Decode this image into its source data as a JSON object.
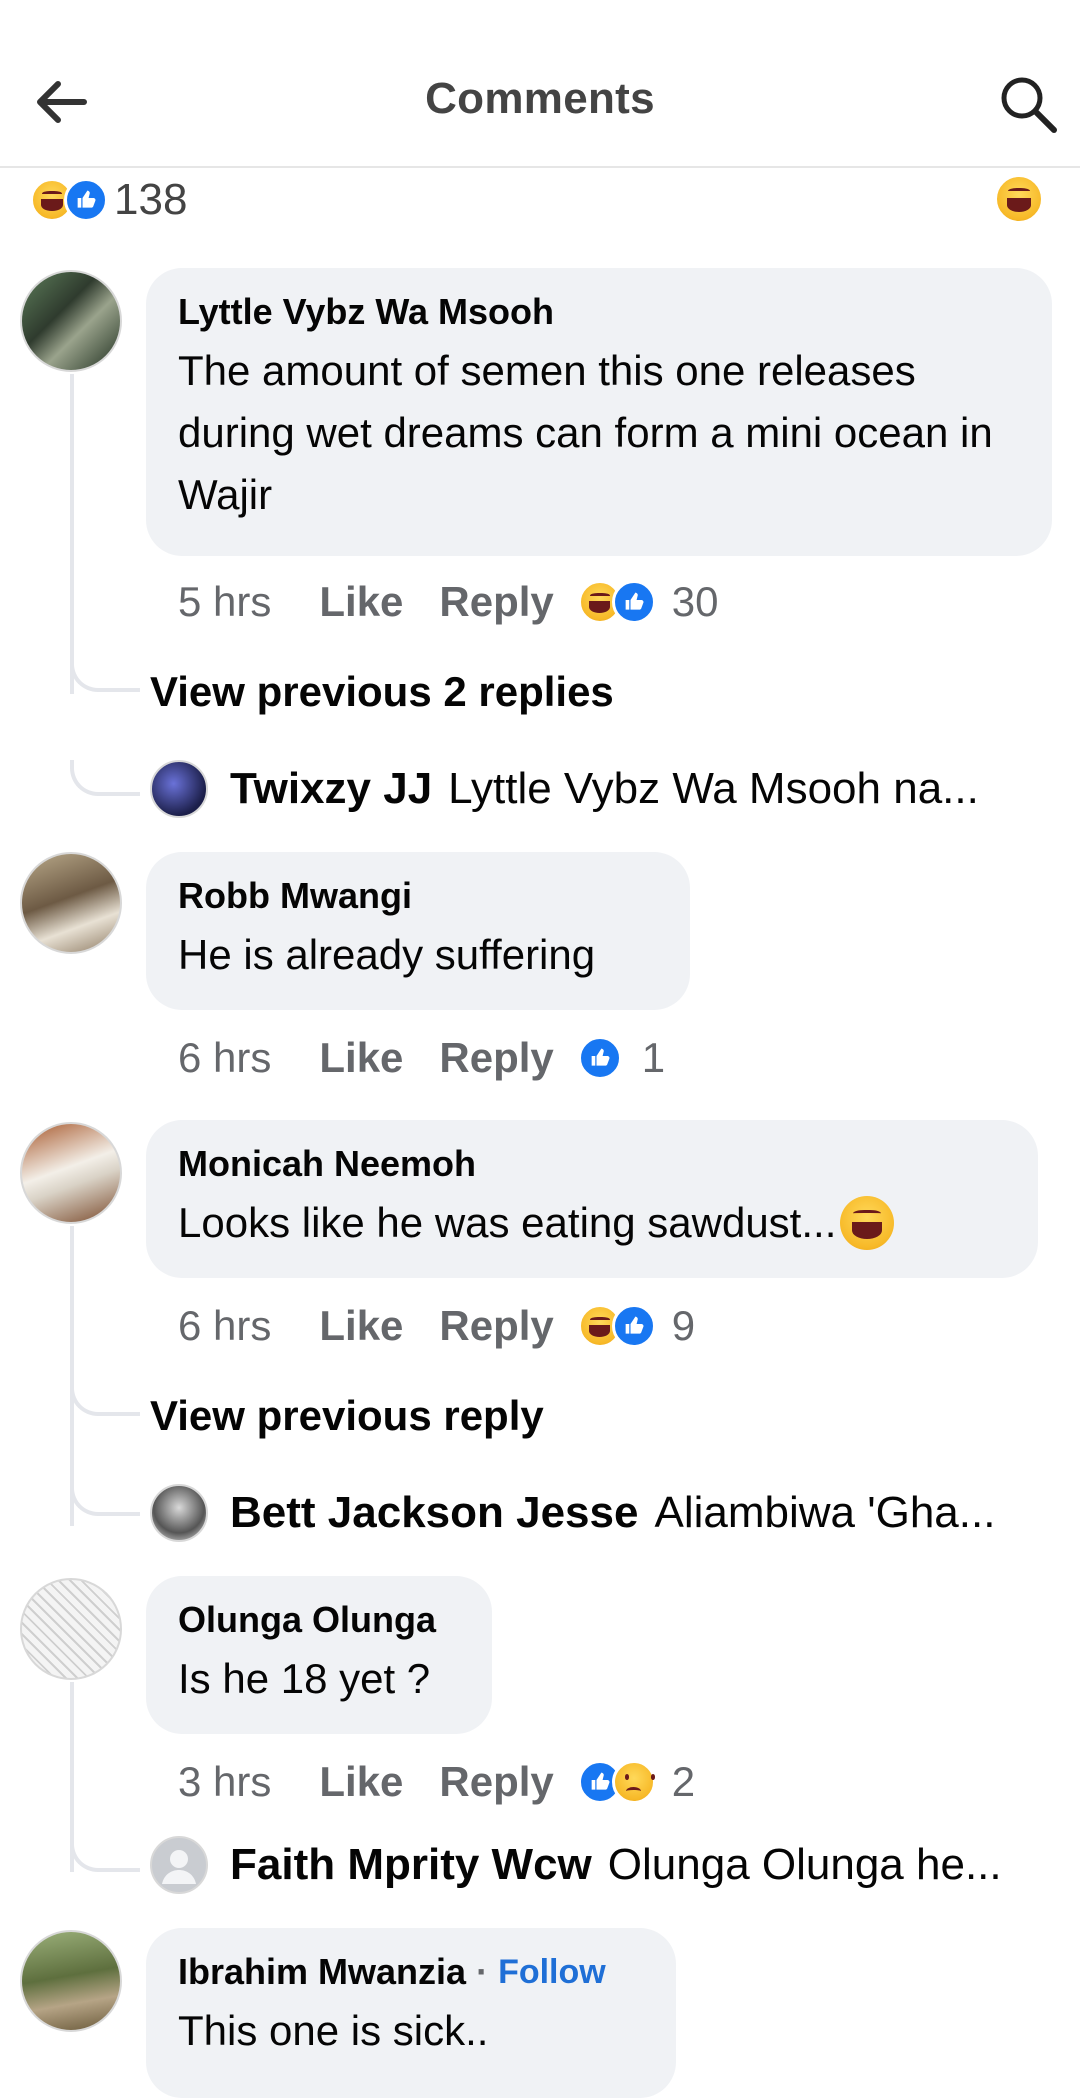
{
  "header": {
    "title": "Comments"
  },
  "summary": {
    "count": "138"
  },
  "comments": [
    {
      "author": "Lyttle Vybz Wa Msooh",
      "text": "The amount of semen this one releases during wet dreams can form a mini ocean in Wajir",
      "time": "5 hrs",
      "like": "Like",
      "reply": "Reply",
      "reaction_count": "30",
      "view_previous": "View previous 2 replies",
      "latest_reply": {
        "name": "Twixzy JJ",
        "text": "Lyttle Vybz Wa Msooh na..."
      }
    },
    {
      "author": "Robb Mwangi",
      "text": "He is already suffering",
      "time": "6 hrs",
      "like": "Like",
      "reply": "Reply",
      "reaction_count": "1"
    },
    {
      "author": "Monicah Neemoh",
      "text": "Looks like he was eating sawdust...",
      "time": "6 hrs",
      "like": "Like",
      "reply": "Reply",
      "reaction_count": "9",
      "view_previous": "View previous reply",
      "latest_reply": {
        "name": "Bett Jackson Jesse",
        "text": "Aliambiwa 'Gha..."
      }
    },
    {
      "author": "Olunga Olunga",
      "text": "Is he 18 yet ?",
      "time": "3 hrs",
      "like": "Like",
      "reply": "Reply",
      "reaction_count": "2",
      "latest_reply": {
        "name": "Faith Mprity Wcw",
        "text": "Olunga Olunga he..."
      }
    },
    {
      "author": "Ibrahim Mwanzia",
      "follow": "Follow",
      "text": "This one is sick.."
    }
  ],
  "colors": {
    "bubble": "#f0f2f5",
    "like_blue": "#1877f2",
    "follow_blue": "#1f6fd6",
    "meta_gray": "#65676b"
  }
}
